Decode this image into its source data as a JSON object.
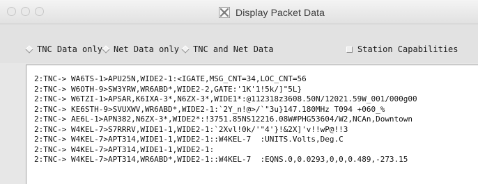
{
  "window": {
    "title": "Display Packet Data"
  },
  "options": {
    "tnc_only": "TNC Data only",
    "net_only": "Net Data only",
    "tnc_and_net": "TNC and Net Data",
    "station_caps": "Station Capabilities"
  },
  "log": {
    "lines": [
      "2:TNC-> WA6TS-1>APU25N,WIDE2-1:<IGATE,MSG_CNT=34,LOC_CNT=56",
      "2:TNC-> W6OTH-9>SW3YRW,WR6ABD*,WIDE2-2,GATE:'1K'1!5k/]\"5L}",
      "2:TNC-> W6TZI-1>APSAR,K6IXA-3*,N6ZX-3*,WIDE1*:@112318z3608.50N/12021.59W_001/000g00",
      "2:TNC-> KE6STH-9>SVUXWV,WR6ABD*,WIDE2-1:`2Y_n!@>/`\"3u}147.180MHz T094 +060_%",
      "2:TNC-> AE6L-1>APN382,N6ZX-3*,WIDE2*:!3751.85NS12216.08W#PHG53604/W2,NCAn,Downtown",
      "2:TNC-> W4KEL-7>S7RRRV,WIDE1-1,WIDE2-1:`2Xvl!0k/'\"4'}!&2X]'v!!wP@!!3",
      "2:TNC-> W4KEL-7>APT314,WIDE1-1,WIDE2-1::W4KEL-7  :UNITS.Volts,Deg.C",
      "2:TNC-> W4KEL-7>APT314,WIDE1-1,WIDE2-1:",
      "2:TNC-> W4KEL-7>APT314,WR6ABD*,WIDE2-1::W4KEL-7  :EQNS.0,0.0293,0,0,0.489,-273.15"
    ]
  }
}
